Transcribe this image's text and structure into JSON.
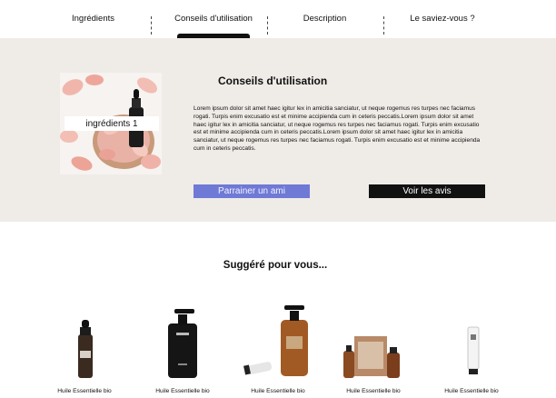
{
  "tabs": [
    {
      "label": "Ingrédients"
    },
    {
      "label": "Conseils d'utilisation"
    },
    {
      "label": "Description"
    },
    {
      "label": "Le saviez-vous ?"
    }
  ],
  "usage": {
    "image_label": "ingrédients 1",
    "title": "Conseils d'utilisation",
    "body": "Lorem ipsum dolor sit amet haec igitur lex in amicitia sanciatur, ut neque rogemus res turpes nec faciamus rogati. Turpis enim excusatio est et minime accipienda cum in ceteris peccatis.Lorem ipsum dolor sit amet haec igitur lex in amicitia sanciatur, ut neque rogemus res turpes nec faciamus rogati. Turpis enim excusatio est et minime accipienda cum in ceteris peccatis.Lorem ipsum dolor sit amet haec igitur lex in amicitia sanciatur, ut neque rogemus res turpes nec faciamus rogati. Turpis enim excusatio est et minime accipienda cum in ceteris peccatis.",
    "refer_button": "Parrainer un ami",
    "reviews_button": "Voir les avis"
  },
  "suggestions": {
    "title": "Suggéré pour vous...",
    "products": [
      {
        "name": "Huile Essentielle bio"
      },
      {
        "name": "Huile Essentielle bio"
      },
      {
        "name": "Huile Essentielle bio"
      },
      {
        "name": "Huile Essentielle bio"
      },
      {
        "name": "Huile Essentielle bio"
      }
    ]
  },
  "colors": {
    "section_bg": "#efebe7",
    "refer_button": "#6f79d6",
    "reviews_button": "#111111"
  }
}
